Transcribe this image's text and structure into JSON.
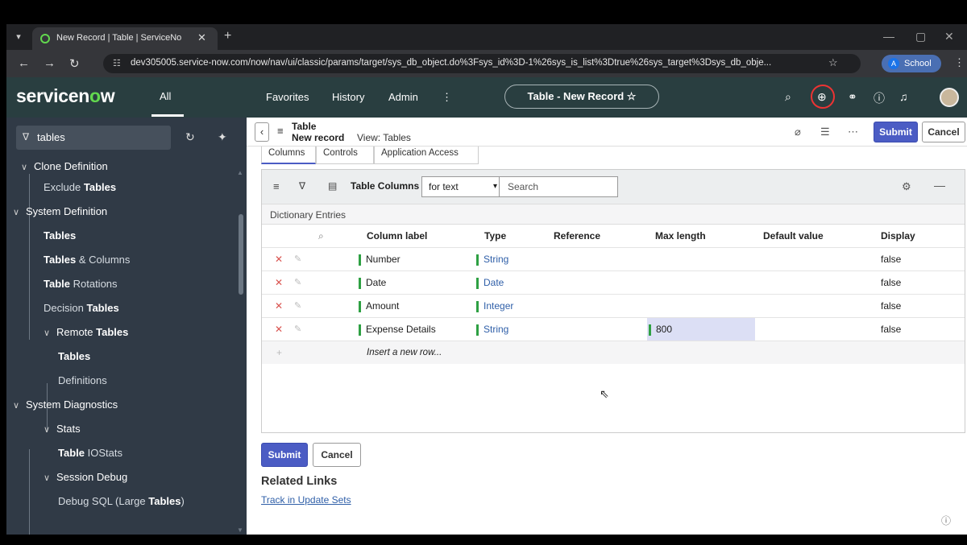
{
  "browser": {
    "tab_title": "New Record | Table | ServiceNo",
    "tab_close": "✕",
    "new_tab": "+",
    "url": "dev305005.service-now.com/now/nav/ui/classic/params/target/sys_db_object.do%3Fsys_id%3D-1%26sys_is_list%3Dtrue%26sys_target%3Dsys_db_obje...",
    "profile_initial": "A",
    "profile_label": "School"
  },
  "header": {
    "logo_pre": "servicen",
    "logo_o": "o",
    "logo_post": "w",
    "all": "All",
    "favorites": "Favorites",
    "history": "History",
    "admin": "Admin",
    "more": "⋮",
    "context_title": "Table - New Record ☆"
  },
  "sidebar": {
    "filter_value": "tables",
    "items": [
      {
        "label": "Clone Definition"
      },
      {
        "pre": "Exclude ",
        "bold": "Tables",
        "post": ""
      },
      {
        "label": "System Definition"
      },
      {
        "pre": "",
        "bold": "Tables",
        "post": ""
      },
      {
        "pre": "",
        "bold": "Tables",
        "post": " & Columns"
      },
      {
        "pre": "",
        "bold": "Table",
        "post": " Rotations"
      },
      {
        "pre": "Decision ",
        "bold": "Tables",
        "post": ""
      },
      {
        "pre": "Remote ",
        "bold": "Tables",
        "post": ""
      },
      {
        "pre": "",
        "bold": "Tables",
        "post": ""
      },
      {
        "label": "Definitions"
      },
      {
        "label": "System Diagnostics"
      },
      {
        "label": "Stats"
      },
      {
        "pre": "",
        "bold": "Table",
        "post": " IOStats"
      },
      {
        "label": "Session Debug"
      },
      {
        "pre": "Debug SQL (Large ",
        "bold": "Tables",
        "post": ")"
      }
    ]
  },
  "form": {
    "title_line1": "Table",
    "title_line2": "New record",
    "view": "View: Tables",
    "submit": "Submit",
    "cancel": "Cancel",
    "tabs": [
      "Columns",
      "Controls",
      "Application Access"
    ]
  },
  "related_list": {
    "title": "Table Columns",
    "search_field": "for text",
    "search_placeholder": "Search",
    "breadcrumb": "Dictionary Entries",
    "headers": [
      "Column label",
      "Type",
      "Reference",
      "Max length",
      "Default value",
      "Display"
    ],
    "rows": [
      {
        "label": "Number",
        "type": "String",
        "reference": "",
        "max_length": "",
        "default": "",
        "display": "false"
      },
      {
        "label": "Date",
        "type": "Date",
        "reference": "",
        "max_length": "",
        "default": "",
        "display": "false"
      },
      {
        "label": "Amount",
        "type": "Integer",
        "reference": "",
        "max_length": "",
        "default": "",
        "display": "false"
      },
      {
        "label": "Expense Details",
        "type": "String",
        "reference": "",
        "max_length": "800",
        "default": "",
        "display": "false"
      }
    ],
    "insert_row": "Insert a new row..."
  },
  "footer": {
    "submit": "Submit",
    "cancel": "Cancel",
    "related_links": "Related Links",
    "track_link": "Track in Update Sets"
  },
  "colors": {
    "header_bg": "#293e40",
    "sidebar_bg": "#303a46",
    "primary": "#4b5cc4",
    "accent_green": "#62d84e"
  }
}
